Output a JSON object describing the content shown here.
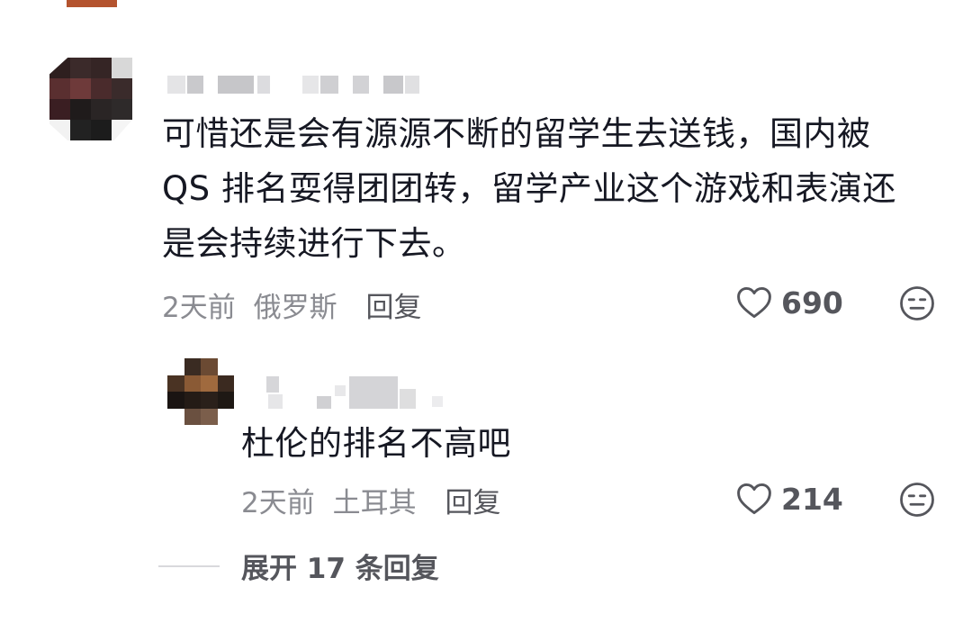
{
  "main_comment": {
    "text_lines": [
      "可惜还是会有源源不断的留学生去送钱，国内被",
      "QS 排名耍得团团转，留学产业这个游戏和表演还",
      "是会持续进行下去。"
    ],
    "time": "2天前",
    "location": "俄罗斯",
    "reply_label": "回复",
    "like_count": "690"
  },
  "reply_comment": {
    "text": "杜伦的排名不高吧",
    "time": "2天前",
    "location": "土耳其",
    "reply_label": "回复",
    "like_count": "214"
  },
  "expand": {
    "label": "展开 17 条回复"
  },
  "colors": {
    "text": "#161823",
    "meta": "#8a8b91",
    "action": "#55565c",
    "divider": "#d9d9dc"
  },
  "icons": {
    "like": "heart-outline-icon",
    "react": "neutral-face-icon"
  }
}
